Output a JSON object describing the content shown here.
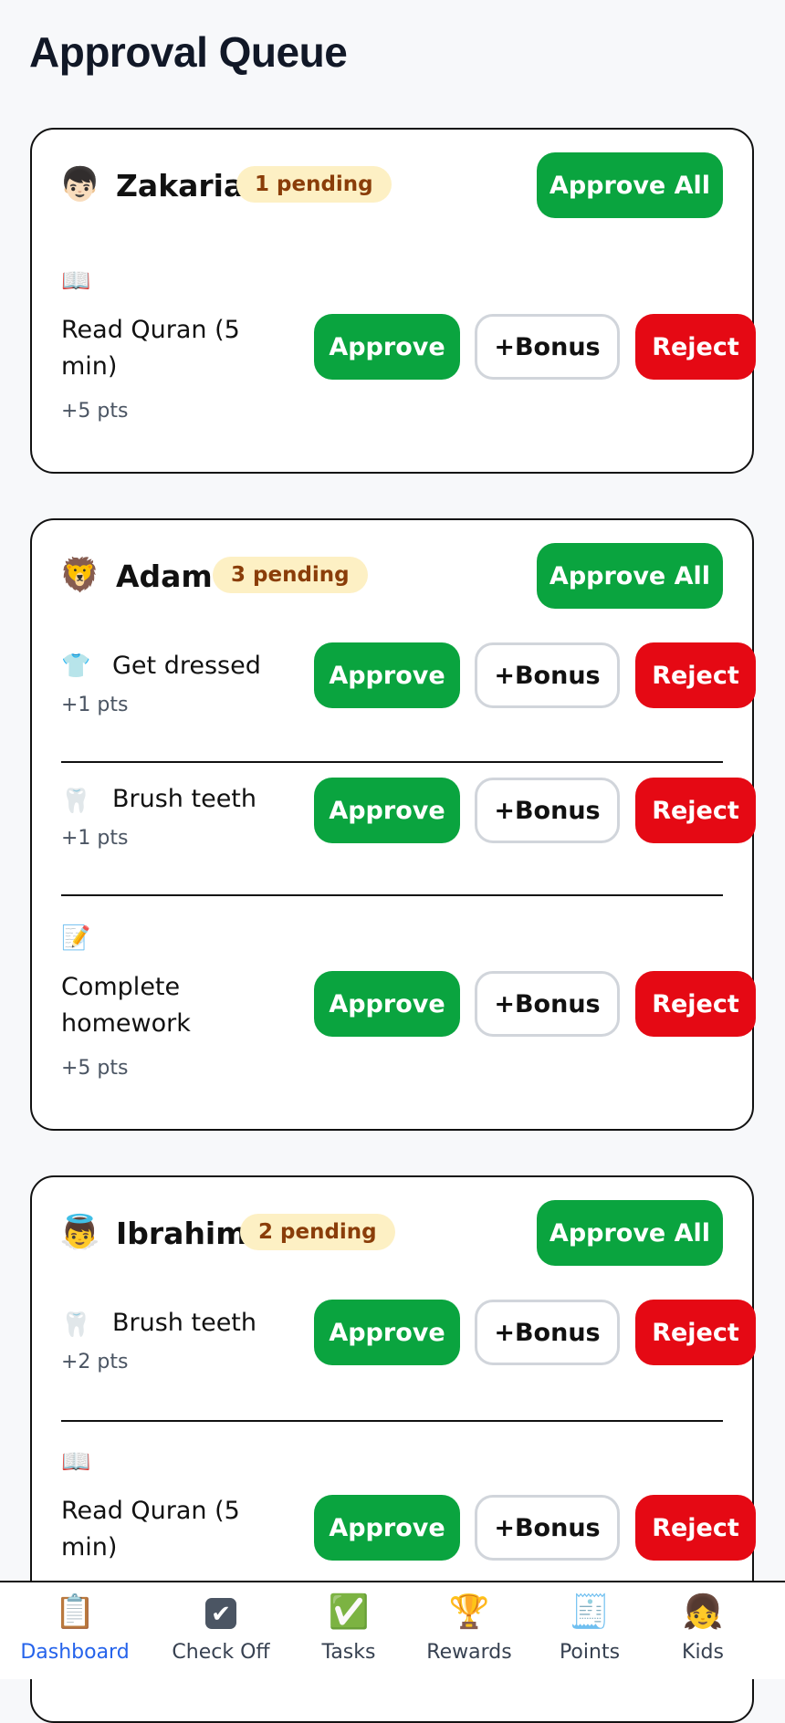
{
  "page": {
    "title": "Approval Queue"
  },
  "actions": {
    "approve": "Approve",
    "bonus": "+Bonus",
    "reject": "Reject",
    "approve_all": "Approve All"
  },
  "kids": [
    {
      "name": "Zakaria",
      "avatar": "👦🏻",
      "pending": "1 pending",
      "tasks": [
        {
          "icon": "📖",
          "name": "Read Quran (5 min)",
          "points": "+5 pts"
        }
      ]
    },
    {
      "name": "Adam",
      "avatar": "🦁",
      "pending": "3 pending",
      "tasks": [
        {
          "icon": "👕",
          "name": "Get dressed",
          "points": "+1 pts"
        },
        {
          "icon": "🦷",
          "name": "Brush teeth",
          "points": "+1 pts"
        },
        {
          "icon": "📝",
          "name": "Complete homework",
          "points": "+5 pts"
        }
      ]
    },
    {
      "name": "Ibrahim",
      "avatar": "👼",
      "pending": "2 pending",
      "tasks": [
        {
          "icon": "🦷",
          "name": "Brush teeth",
          "points": "+2 pts"
        },
        {
          "icon": "📖",
          "name": "Read Quran (5 min)",
          "points": ""
        }
      ]
    }
  ],
  "nav": {
    "items": [
      {
        "label": "Dashboard",
        "icon": "📋"
      },
      {
        "label": "Check Off",
        "icon": "✔"
      },
      {
        "label": "Tasks",
        "icon": "✅"
      },
      {
        "label": "Rewards",
        "icon": "🏆"
      },
      {
        "label": "Points",
        "icon": "🧾"
      },
      {
        "label": "Kids",
        "icon": "👧"
      }
    ]
  },
  "colors": {
    "approve": "#0aa43f",
    "reject": "#e50914",
    "badge_bg": "#fdf0c4",
    "badge_text": "#8a3d09",
    "nav_active": "#2563eb"
  }
}
